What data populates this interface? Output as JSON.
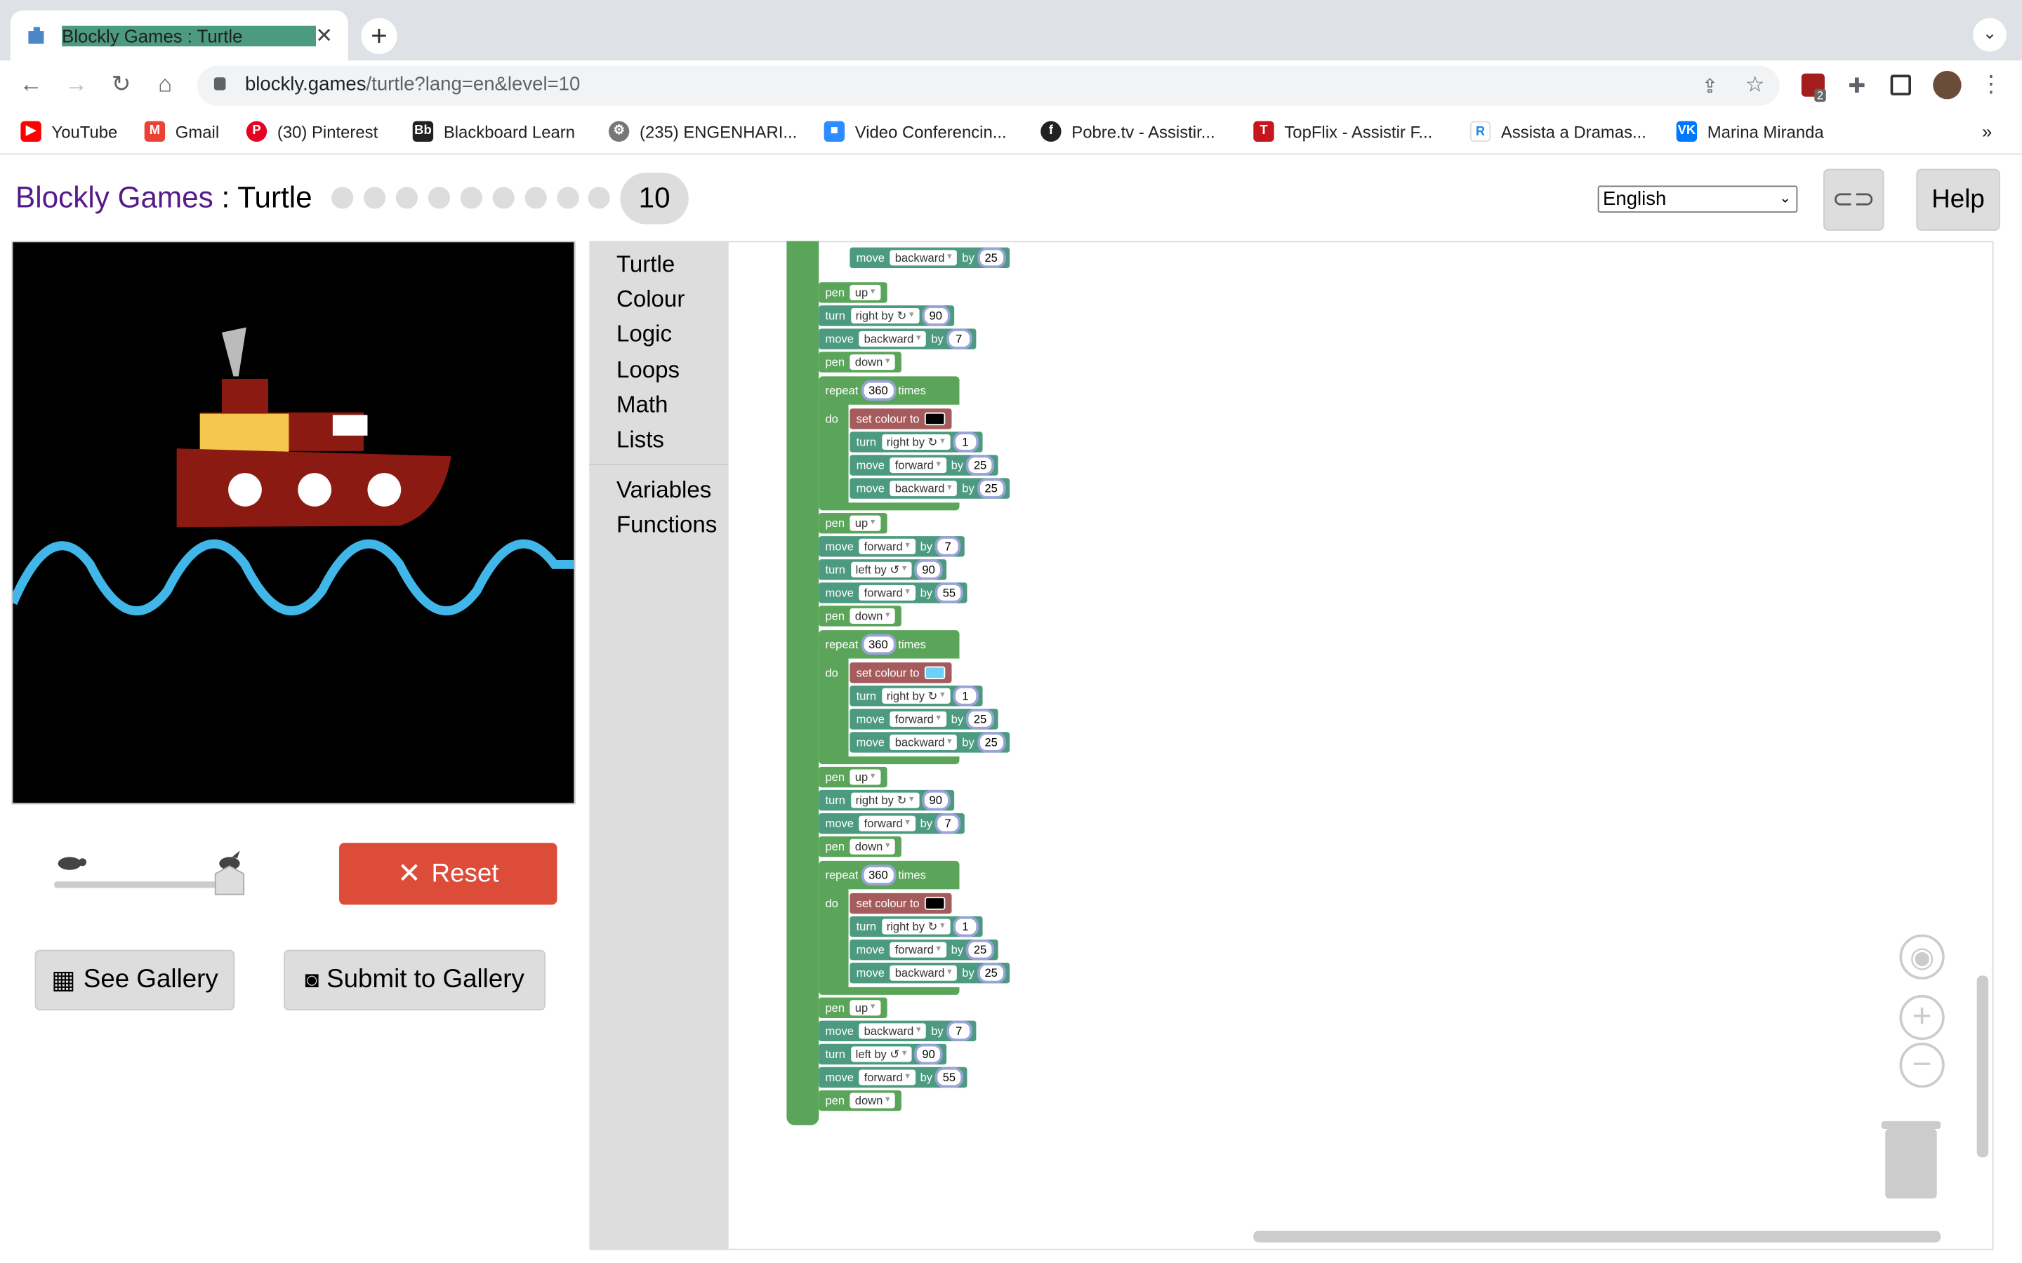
{
  "browser": {
    "tab_title": "Blockly Games : Turtle",
    "new_tab": "+",
    "url_host": "blockly.games",
    "url_path": "/turtle?lang=en&level=10",
    "bookmarks": [
      "YouTube",
      "Gmail",
      "(30) Pinterest",
      "Blackboard Learn",
      "(235) ENGENHARI...",
      "Video Conferencin...",
      "Pobre.tv - Assistir...",
      "TopFlix - Assistir F...",
      "Assista a Dramas...",
      "Marina Miranda"
    ],
    "bookmark_colors": [
      "#ff0000",
      "#ea4335",
      "#e60023",
      "#222222",
      "#666666",
      "#2d8cff",
      "#222222",
      "#c4161c",
      "#1e88e5",
      "#0077ff"
    ],
    "more": "»",
    "extension_badge": "2"
  },
  "header": {
    "brand": "Blockly Games",
    "sep": " : ",
    "game": "Turtle",
    "level": "10",
    "language": "English",
    "help": "Help"
  },
  "controls": {
    "reset": "Reset",
    "see_gallery": "See Gallery",
    "submit_gallery": "Submit to Gallery",
    "speed": 1.0
  },
  "toolbox": [
    "Turtle",
    "Colour",
    "Logic",
    "Loops",
    "Math",
    "Lists",
    "Variables",
    "Functions"
  ],
  "blocks": {
    "pen": "pen",
    "up": "up",
    "down": "down",
    "turn": "turn",
    "right_by": "right by ↻",
    "left_by": "left by ↺",
    "move": "move",
    "forward": "forward",
    "backward": "backward",
    "by": "by",
    "repeat": "repeat",
    "times": "times",
    "do": "do",
    "set_colour": "set colour to",
    "n90": "90",
    "n7": "7",
    "n25": "25",
    "n1": "1",
    "n360": "360",
    "n55": "55",
    "black": "#000000",
    "light_blue": "#6dd0f7"
  },
  "colors": {
    "boat_hull": "#8b1a12",
    "boat_cabin": "#f5c74d",
    "waves": "#40b7e8",
    "reset": "#dd4b39"
  }
}
